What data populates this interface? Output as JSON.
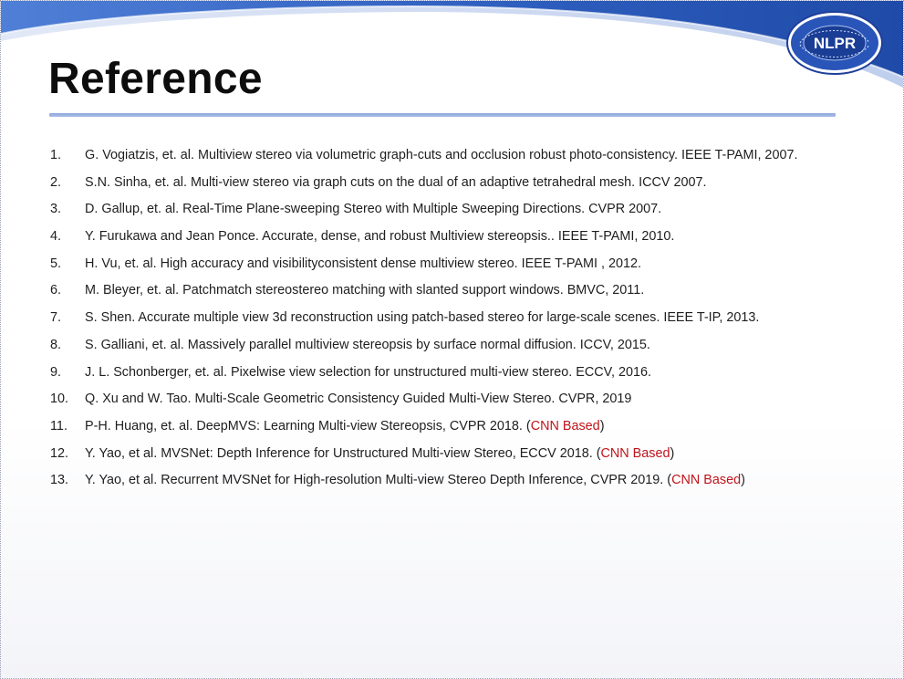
{
  "slide": {
    "title": "Reference",
    "logo_text": "NLPR",
    "logo_ring_text": "LABORATORY OF PATTERN RECOGNITION"
  },
  "colors": {
    "title": "#0d0d0d",
    "rule": "#a3b6e2",
    "swoosh": "#2f5fbf",
    "highlight": "#c0141b"
  },
  "references": [
    {
      "num": "1.",
      "text": "G. Vogiatzis, et. al. Multiview stereo via volumetric graph-cuts and occlusion robust photo-consistency. IEEE T-PAMI, 2007."
    },
    {
      "num": "2.",
      "text": "S.N. Sinha, et. al. Multi-view stereo via graph cuts on the dual of an adaptive tetrahedral mesh. ICCV 2007."
    },
    {
      "num": "3.",
      "text": "D. Gallup, et. al. Real-Time Plane-sweeping Stereo with Multiple Sweeping Directions. CVPR 2007."
    },
    {
      "num": "4.",
      "text": "Y. Furukawa and Jean Ponce. Accurate, dense, and robust Multiview stereopsis.. IEEE T-PAMI, 2010."
    },
    {
      "num": "5.",
      "text": "H. Vu, et. al. High accuracy and visibilityconsistent dense multiview stereo. IEEE T-PAMI , 2012."
    },
    {
      "num": "6.",
      "text": "M. Bleyer, et. al. Patchmatch stereostereo matching with slanted support windows. BMVC, 2011."
    },
    {
      "num": "7.",
      "text": "S. Shen. Accurate multiple view 3d reconstruction using patch-based stereo for large-scale scenes. IEEE T-IP, 2013."
    },
    {
      "num": "8.",
      "text": "S. Galliani, et. al. Massively parallel multiview stereopsis by surface normal diffusion. ICCV, 2015."
    },
    {
      "num": "9.",
      "text": "J. L. Schonberger, et. al. Pixelwise view selection for unstructured multi-view stereo. ECCV, 2016."
    },
    {
      "num": "10.",
      "text": "Q. Xu and W. Tao. Multi-Scale Geometric Consistency Guided Multi-View Stereo. CVPR, 2019"
    },
    {
      "num": "11.",
      "text": "P-H. Huang, et. al. DeepMVS: Learning Multi-view Stereopsis, CVPR 2018. (",
      "tag": "CNN Based",
      "close": ")"
    },
    {
      "num": "12.",
      "text": "Y. Yao, et al. MVSNet: Depth Inference for Unstructured Multi-view Stereo, ECCV 2018. (",
      "tag": "CNN Based",
      "close": ")"
    },
    {
      "num": "13.",
      "text": "Y. Yao, et al. Recurrent MVSNet for High-resolution Multi-view Stereo Depth Inference, CVPR 2019. (",
      "tag": "CNN Based",
      "close": ")"
    }
  ]
}
